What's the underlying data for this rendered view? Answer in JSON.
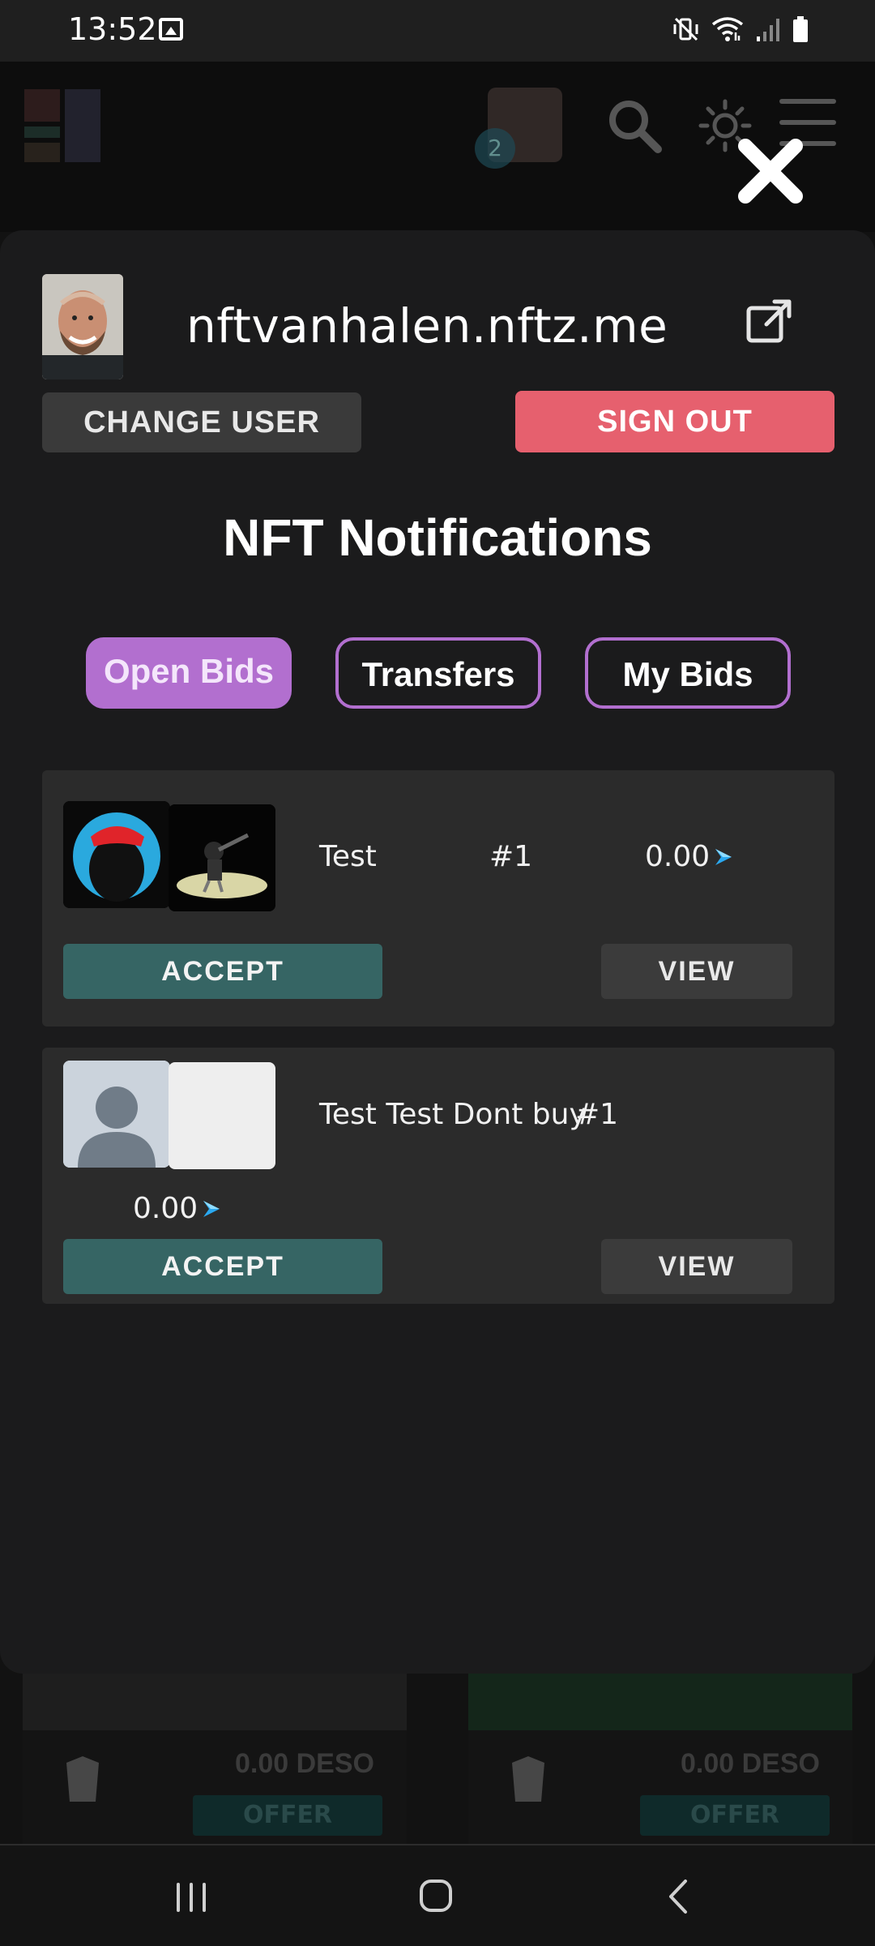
{
  "status_bar": {
    "time": "13:52",
    "icons": [
      "gallery-icon",
      "mute-vibrate-icon",
      "wifi-icon",
      "signal-icon",
      "battery-icon"
    ]
  },
  "background": {
    "notification_count": "2",
    "cards": [
      {
        "price": "0.00  DESO",
        "offer": "OFFER"
      },
      {
        "price": "0.00  DESO",
        "offer": "OFFER"
      }
    ]
  },
  "user": {
    "username": "nftvanhalen.nftz.me",
    "change_user_label": "CHANGE USER",
    "sign_out_label": "SIGN OUT"
  },
  "notifications": {
    "title": "NFT Notifications",
    "tabs": [
      {
        "label": "Open Bids",
        "active": true
      },
      {
        "label": "Transfers",
        "active": false
      },
      {
        "label": "My Bids",
        "active": false
      }
    ],
    "bids": [
      {
        "name": "Test",
        "edition": "#1",
        "price": "0.00",
        "accept_label": "ACCEPT",
        "view_label": "VIEW"
      },
      {
        "name": "Test Test Dont buy",
        "edition": "#1",
        "price": "0.00",
        "accept_label": "ACCEPT",
        "view_label": "VIEW"
      }
    ]
  },
  "colors": {
    "accent_purple": "#b26fcf",
    "sign_out_red": "#e6606e",
    "accept_teal": "#366564",
    "deso_blue": "#2aa8f0"
  }
}
